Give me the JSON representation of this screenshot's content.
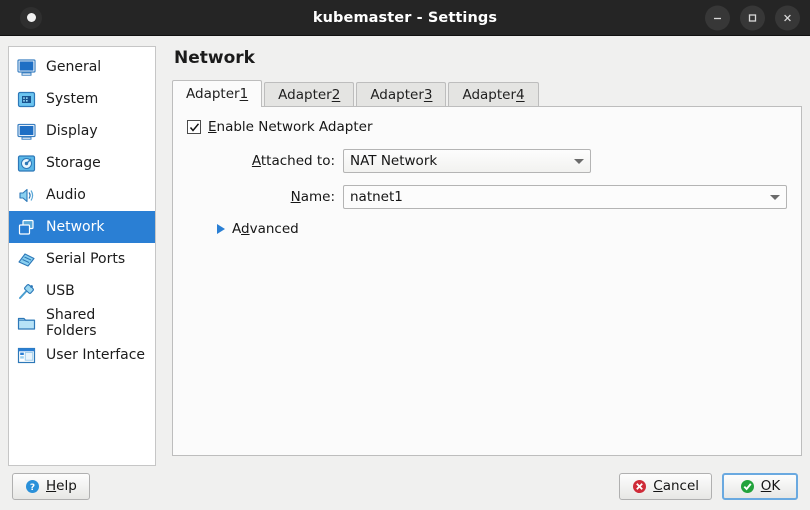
{
  "window": {
    "title": "kubemaster - Settings",
    "app_icon": "circle-dot-icon",
    "controls": {
      "minimize": "minimize-icon",
      "maximize": "maximize-icon",
      "close": "close-icon"
    }
  },
  "sidebar": {
    "items": [
      {
        "label": "General",
        "icon": "monitor-icon",
        "selected": false
      },
      {
        "label": "System",
        "icon": "motherboard-icon",
        "selected": false
      },
      {
        "label": "Display",
        "icon": "display-icon",
        "selected": false
      },
      {
        "label": "Storage",
        "icon": "harddisk-icon",
        "selected": false
      },
      {
        "label": "Audio",
        "icon": "speaker-icon",
        "selected": false
      },
      {
        "label": "Network",
        "icon": "network-cards-icon",
        "selected": true
      },
      {
        "label": "Serial Ports",
        "icon": "serial-port-icon",
        "selected": false
      },
      {
        "label": "USB",
        "icon": "usb-plug-icon",
        "selected": false
      },
      {
        "label": "Shared Folders",
        "icon": "folder-icon",
        "selected": false
      },
      {
        "label": "User Interface",
        "icon": "window-layout-icon",
        "selected": false
      }
    ],
    "selected_color": "#2a7fd4"
  },
  "main": {
    "page_title": "Network",
    "tabs": [
      {
        "label_prefix": "Adapter ",
        "mnemonic": "1",
        "active": true
      },
      {
        "label_prefix": "Adapter ",
        "mnemonic": "2",
        "active": false
      },
      {
        "label_prefix": "Adapter ",
        "mnemonic": "3",
        "active": false
      },
      {
        "label_prefix": "Adapter ",
        "mnemonic": "4",
        "active": false
      }
    ],
    "enable_adapter": {
      "checked": true,
      "label_mnemonic": "E",
      "label_rest": "nable Network Adapter"
    },
    "fields": [
      {
        "label_mnemonic": "A",
        "label_rest": "ttached to:",
        "value": "NAT Network",
        "control": "combobox"
      },
      {
        "label_mnemonic": "N",
        "label_rest": "ame:",
        "value": "natnet1",
        "control": "combobox"
      }
    ],
    "advanced": {
      "label_pre": "A",
      "label_mnemonic": "d",
      "label_rest": "vanced",
      "expanded": false,
      "arrow_color": "#2a7fd4"
    }
  },
  "footer": {
    "help": {
      "label_mnemonic": "H",
      "label_rest": "elp",
      "icon": "help-question-icon",
      "icon_color": "#2a90d9"
    },
    "cancel": {
      "label_pre": "",
      "label_mnemonic": "C",
      "label_rest": "ancel",
      "icon": "error-x-icon",
      "icon_color": "#cf2b38"
    },
    "ok": {
      "label_mnemonic": "O",
      "label_rest": "K",
      "icon": "success-check-icon",
      "icon_color": "#23a33c",
      "focused": true
    }
  }
}
